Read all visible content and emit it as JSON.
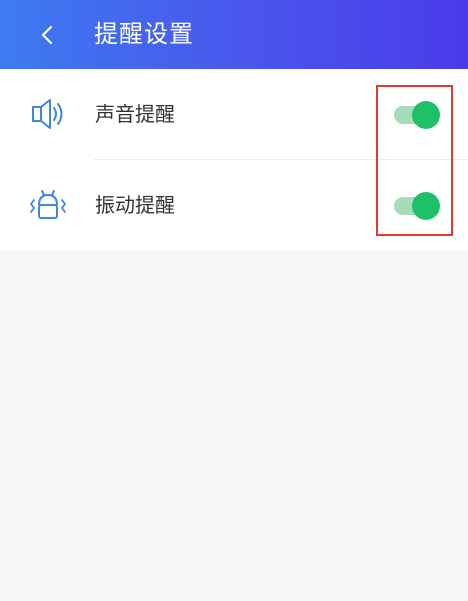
{
  "header": {
    "title": "提醒设置",
    "back_icon": "chevron-left-icon"
  },
  "settings": [
    {
      "label": "声音提醒",
      "icon": "speaker-icon",
      "enabled": true
    },
    {
      "label": "振动提醒",
      "icon": "vibrate-icon",
      "enabled": true
    }
  ],
  "colors": {
    "header_start": "#3d7bf0",
    "header_end": "#4a3bea",
    "toggle_on": "#1fc168",
    "toggle_track": "#a7dcbb",
    "icon_blue": "#3f86de",
    "highlight": "#e53935"
  }
}
